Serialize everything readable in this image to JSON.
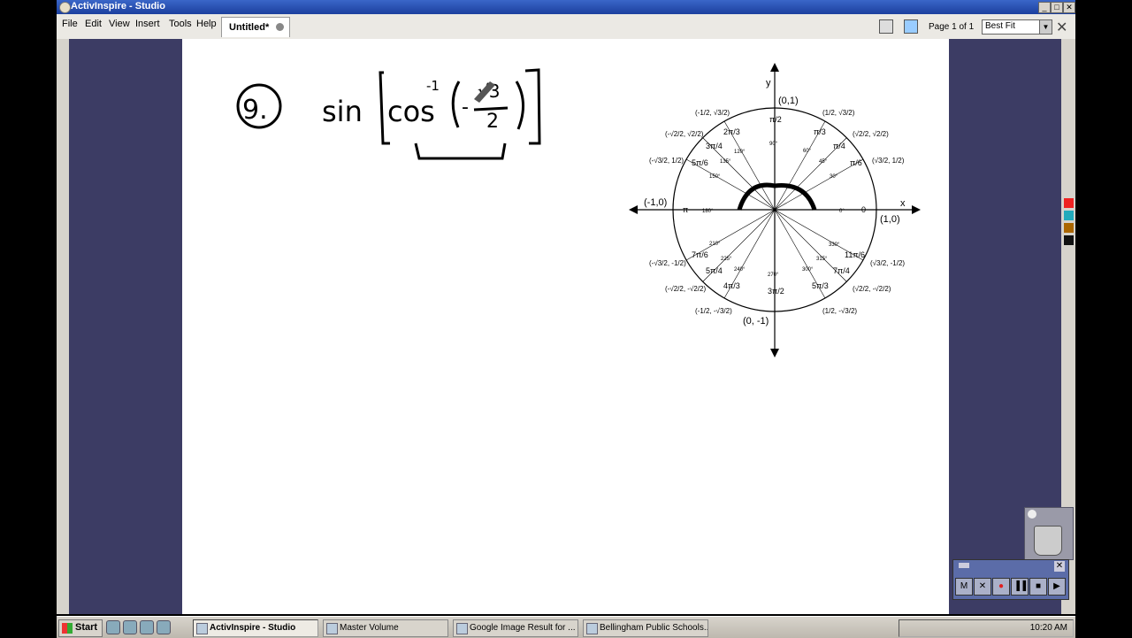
{
  "window": {
    "title": "ActivInspire - Studio"
  },
  "menu": [
    "File",
    "Edit",
    "View",
    "Insert",
    "Tools",
    "Help"
  ],
  "tab": {
    "label": "Untitled*"
  },
  "page_indicator": "Page 1 of 1",
  "zoom": {
    "value": "Best Fit"
  },
  "handwriting": {
    "problem_number": "9.",
    "func": "sin",
    "inner": "cos",
    "exponent": "-1",
    "neg": "-",
    "num": "√3",
    "den": "2"
  },
  "unit_circle": {
    "axis_x": "x",
    "axis_y": "y",
    "top_point": "(0,1)",
    "bottom_point": "(0, -1)",
    "left_point": "(-1,0)",
    "right_point": "(1,0)",
    "top_angle": "π/2",
    "bottom_angle": "3π/2",
    "left_angle": "π",
    "right_angle": "0",
    "deg": [
      "90°",
      "60°",
      "45°",
      "30°",
      "0°",
      "330°",
      "315°",
      "300°",
      "270°",
      "240°",
      "225°",
      "210°",
      "180°",
      "150°",
      "135°",
      "120°"
    ],
    "rad": [
      "π/3",
      "π/4",
      "π/6",
      "11π/6",
      "7π/4",
      "5π/3",
      "4π/3",
      "5π/4",
      "7π/6",
      "5π/6",
      "3π/4",
      "2π/3"
    ],
    "coords": [
      "(1/2, √3/2)",
      "(√2/2, √2/2)",
      "(√3/2, 1/2)",
      "(√3/2, -1/2)",
      "(√2/2, -√2/2)",
      "(1/2, -√3/2)",
      "(-1/2, -√3/2)",
      "(-√2/2, -√2/2)",
      "(-√3/2, -1/2)",
      "(-√3/2, 1/2)",
      "(-√2/2, √2/2)",
      "(-1/2, √3/2)"
    ]
  },
  "recorder": {
    "buttons": [
      "M",
      "✕",
      "●",
      "▐▐",
      "■",
      "▶"
    ]
  },
  "taskbar": {
    "start": "Start",
    "tasks": [
      "ActivInspire - Studio",
      "Master Volume",
      "Google Image Result for ...",
      "Bellingham Public Schools..."
    ],
    "clock": "10:20 AM"
  },
  "colors": {
    "panel": "#3c3c64",
    "titlebar": "#1b3f9e",
    "canvas": "#ffffff",
    "record": "#e02020"
  }
}
